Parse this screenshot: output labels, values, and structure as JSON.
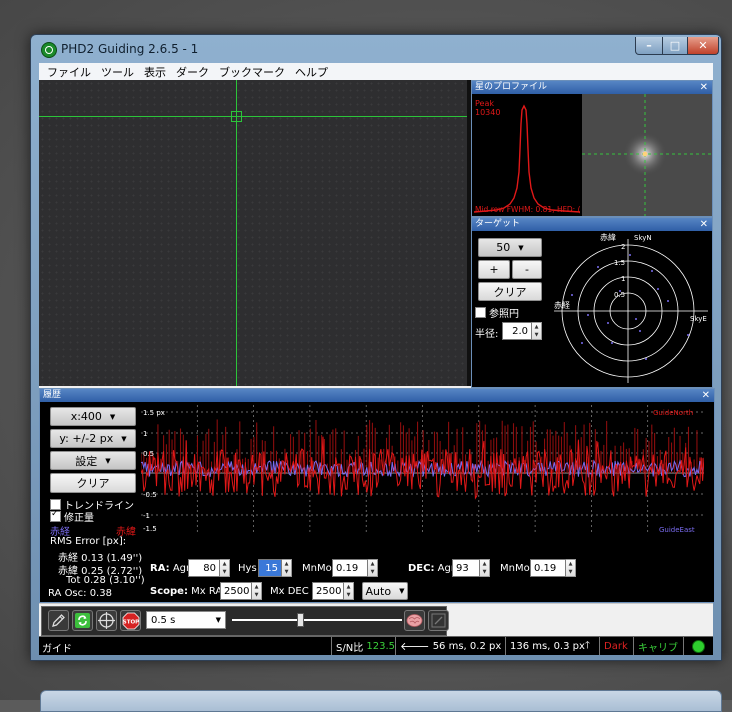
{
  "window": {
    "title": "PHD2 Guiding 2.6.5 - 1",
    "controls": {
      "minimize": "–",
      "maximize": "□",
      "close": "✕"
    }
  },
  "menu": [
    "ファイル",
    "ツール",
    "表示",
    "ダーク",
    "ブックマーク",
    "ヘルプ"
  ],
  "profile": {
    "title": "星のプロファイル",
    "close": "✕",
    "peak_label": "Peak",
    "peak_value": "10340",
    "footer": "Mid row FWHM: 0.81, HFD: (",
    "star_color": "#ffd27a"
  },
  "target": {
    "title": "ターゲット",
    "close": "✕",
    "zoom_value": "50",
    "plus_label": "+",
    "minus_label": "-",
    "clear_label": "クリア",
    "ref_circle_label": "参照円",
    "radius_label": "半径:",
    "radius_value": "2.0",
    "axis_dec": "赤緯",
    "axis_ra": "赤経",
    "sky_n": "SkyN",
    "sky_e": "SkyE",
    "ring_labels": [
      "2",
      "1.5",
      "1",
      "0.5"
    ]
  },
  "history": {
    "title": "履歴",
    "close": "✕",
    "x_scale": "x:400",
    "y_scale": "y: +/-2 px",
    "settings": "設定",
    "clear": "クリア",
    "trendline": "トレンドライン",
    "corrections": "修正量",
    "legend_ra": "赤経",
    "legend_dec": "赤緯",
    "rms_title": "RMS Error [px]:",
    "rms_ra": "赤経 0.13 (1.49'')",
    "rms_dec": "赤緯 0.25 (2.72'')",
    "rms_tot": "Tot 0.28 (3.10'')",
    "ra_osc": "RA Osc: 0.38",
    "y_ticks": [
      "1.5 px",
      "1",
      "0.5",
      "-0.5",
      "-1",
      "-1.5"
    ],
    "guide_north": "GuideNorth",
    "guide_east": "GuideEast",
    "ra_color": "#e01818",
    "dec_color": "#7a6cf0"
  },
  "params": {
    "ra_label": "RA:",
    "agr_label": "Agr",
    "ra_agr": "80",
    "hys_label": "Hys",
    "hys": "15",
    "mnmo_label": "MnMo",
    "ra_mnmo": "0.19",
    "dec_label": "DEC:",
    "dec_agr": "93",
    "dec_mnmo": "0.19",
    "scope_label": "Scope:",
    "mxra_label": "Mx RA",
    "mx_ra": "2500",
    "mxdec_label": "Mx DEC",
    "mx_dec": "2500",
    "mode": "Auto"
  },
  "toolbar": {
    "exposure": "0.5 s",
    "stop_label": "STOP",
    "gamma_fraction": 0.4
  },
  "status": {
    "mode": "ガイド",
    "snr_label": "S/N比",
    "snr_value": "123.5",
    "pulse1": "56 ms, 0.2 px",
    "pulse2": "136 ms, 0.3 px",
    "dark": "Dark",
    "calib": "キャリブ"
  }
}
